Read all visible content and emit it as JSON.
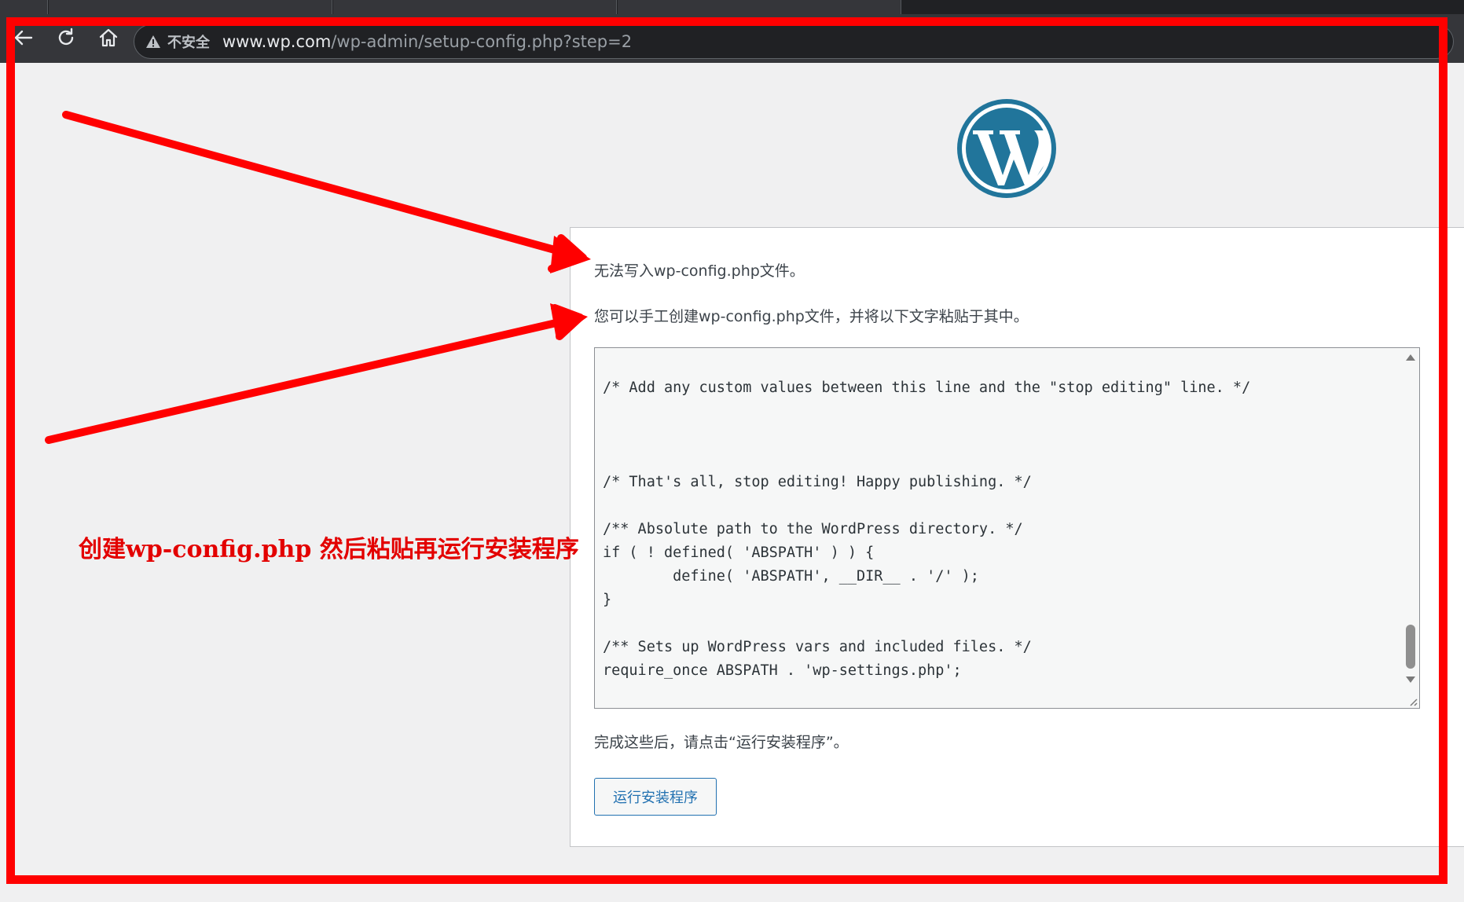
{
  "browser": {
    "security_label": "不安全",
    "url_host": "www.wp.com",
    "url_path": "/wp-admin/setup-config.php?step=2",
    "icons": [
      "back-arrow-icon",
      "reload-icon",
      "home-icon",
      "warning-triangle-icon"
    ]
  },
  "setup": {
    "message_1": "无法写入wp-config.php文件。",
    "message_2": "您可以手工创建wp-config.php文件，并将以下文字粘贴于其中。",
    "config_code": "\t\t\t\t\t\t\t\t\t\t\t\t\t\t\t\t\t\t\t\t\t\t\n\n/* Add any custom values between this line and the \"stop editing\" line. */\n\n\n\n/* That's all, stop editing! Happy publishing. */\n\n/** Absolute path to the WordPress directory. */\nif ( ! defined( 'ABSPATH' ) ) {\n\tdefine( 'ABSPATH', __DIR__ . '/' );\n}\n\n/** Sets up WordPress vars and included files. */\nrequire_once ABSPATH . 'wp-settings.php';",
    "message_3": "完成这些后，请点击“运行安装程序”。",
    "run_install_button": "运行安装程序"
  },
  "annotation": {
    "caption": "创建wp-config.php 然后粘贴再运行安装程序",
    "color": "#ff0000"
  },
  "colors": {
    "wp_blue": "#2271b1",
    "logo_blue": "#21759b",
    "page_bg": "#f0f0f1"
  }
}
